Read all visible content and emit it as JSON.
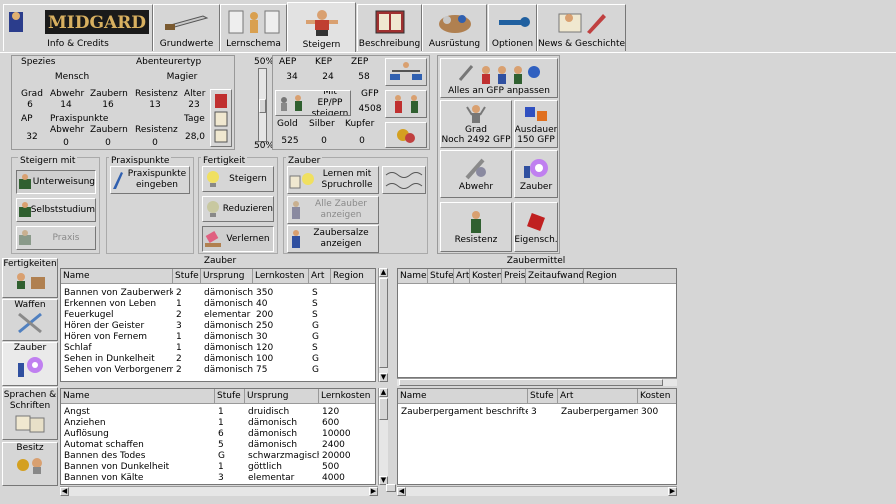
{
  "tabs": [
    {
      "label": "Info & Credits",
      "logo": "MIDGARD"
    },
    {
      "label": "Grundwerte"
    },
    {
      "label": "Lernschema"
    },
    {
      "label": "Steigern"
    },
    {
      "label": "Beschreibung"
    },
    {
      "label": "Ausrüstung"
    },
    {
      "label": "Optionen"
    },
    {
      "label": "News & Geschichte"
    }
  ],
  "char": {
    "spezies_label": "Spezies",
    "spezies": "Mensch",
    "typ_label": "Abenteurertyp",
    "typ": "Magier",
    "grad_label": "Grad",
    "grad": "6",
    "abwehr_label": "Abwehr",
    "abwehr": "14",
    "zaubern_label": "Zaubern",
    "zaubern": "16",
    "resistenz_label": "Resistenz",
    "resistenz": "13",
    "alter_label": "Alter",
    "alter": "23",
    "ap_label": "AP",
    "ap": "32",
    "pp_label": "Praxispunkte",
    "pp_abwehr_label": "Abwehr",
    "pp_abwehr": "0",
    "pp_zaubern_label": "Zaubern",
    "pp_zaubern": "0",
    "pp_resistenz_label": "Resistenz",
    "pp_resistenz": "0",
    "tage_label": "Tage",
    "tage": "28,0"
  },
  "percent": {
    "top": "50%",
    "bottom": "50%"
  },
  "points": {
    "aep_label": "AEP",
    "aep": "34",
    "kep_label": "KEP",
    "kep": "24",
    "zep_label": "ZEP",
    "zep": "58",
    "gfp_label": "GFP",
    "gfp": "4508",
    "mit_ep_label": "Mit EP/PP steigern",
    "gold_label": "Gold",
    "gold": "525",
    "silber_label": "Silber",
    "silber": "0",
    "kupfer_label": "Kupfer",
    "kupfer": "0"
  },
  "steigern_mit": {
    "title": "Steigern mit",
    "unterweisung": "Unterweisung",
    "selbststudium": "Selbststudium",
    "praxis": "Praxis"
  },
  "praxispunkte": {
    "title": "Praxispunkte",
    "button": "Praxispunkte eingeben"
  },
  "fertigkeit": {
    "title": "Fertigkeit",
    "steigern": "Steigern",
    "reduzieren": "Reduzieren",
    "verlernen": "Verlernen"
  },
  "zauber_grp": {
    "title": "Zauber",
    "lernen": "Lernen mit Spruchrolle",
    "alle": "Alle Zauber anzeigen",
    "salze": "Zaubersalze anzeigen"
  },
  "right_panel": {
    "alles": "Alles an GFP anpassen",
    "grad_line1": "Grad",
    "grad_line2": "Noch 2492 GFP",
    "ausdauer_line1": "Ausdauer",
    "ausdauer_line2": "150 GFP",
    "abwehr": "Abwehr",
    "zauber": "Zauber",
    "resistenz": "Resistenz",
    "eigensch": "Eigensch."
  },
  "sidebar": [
    {
      "label": "Fertigkeiten"
    },
    {
      "label": "Waffen"
    },
    {
      "label": "Zauber"
    },
    {
      "label": "Sprachen & Schriften"
    },
    {
      "label": "Besitz"
    }
  ],
  "zauber_section": {
    "title": "Zauber"
  },
  "zaubermittel_section": {
    "title": "Zaubermittel"
  },
  "learned_spells": {
    "columns": [
      "Name",
      "Stufe",
      "Ursprung",
      "Lernkosten",
      "Art",
      "Region"
    ],
    "rows": [
      [
        "Bannen von Zauberwerk",
        "2",
        "dämonisch",
        "350",
        "S",
        ""
      ],
      [
        "Erkennen von Leben",
        "1",
        "dämonisch",
        "40",
        "S",
        ""
      ],
      [
        "Feuerkugel",
        "2",
        "elementar",
        "200",
        "S",
        ""
      ],
      [
        "Hören der Geister",
        "3",
        "dämonisch",
        "250",
        "G",
        ""
      ],
      [
        "Hören von Fernem",
        "1",
        "dämonisch",
        "30",
        "G",
        ""
      ],
      [
        "Schlaf",
        "1",
        "dämonisch",
        "120",
        "S",
        ""
      ],
      [
        "Sehen in Dunkelheit",
        "2",
        "dämonisch",
        "100",
        "G",
        ""
      ],
      [
        "Sehen von Verborgenem",
        "2",
        "dämonisch",
        "75",
        "G",
        ""
      ]
    ]
  },
  "available_spells": {
    "columns": [
      "Name",
      "Stufe",
      "Ursprung",
      "Lernkosten"
    ],
    "rows": [
      [
        "Angst",
        "1",
        "druidisch",
        "120"
      ],
      [
        "Anziehen",
        "1",
        "dämonisch",
        "600"
      ],
      [
        "Auflösung",
        "6",
        "dämonisch",
        "10000"
      ],
      [
        "Automat schaffen",
        "5",
        "dämonisch",
        "2400"
      ],
      [
        "Bannen des Todes",
        "G",
        "schwarzmagisch",
        "20000"
      ],
      [
        "Bannen von Dunkelheit",
        "1",
        "göttlich",
        "500"
      ],
      [
        "Bannen von Kälte",
        "3",
        "elementar",
        "4000"
      ]
    ]
  },
  "learned_mittel": {
    "columns": [
      "Name",
      "Stufe",
      "Art",
      "Kosten",
      "Preis",
      "Zeitaufwand",
      "Region"
    ],
    "rows": []
  },
  "available_mittel": {
    "columns": [
      "Name",
      "Stufe",
      "Art",
      "Kosten"
    ],
    "rows": [
      [
        "Zauberpergament beschriften",
        "3",
        "Zauberpergament",
        "300"
      ]
    ]
  }
}
